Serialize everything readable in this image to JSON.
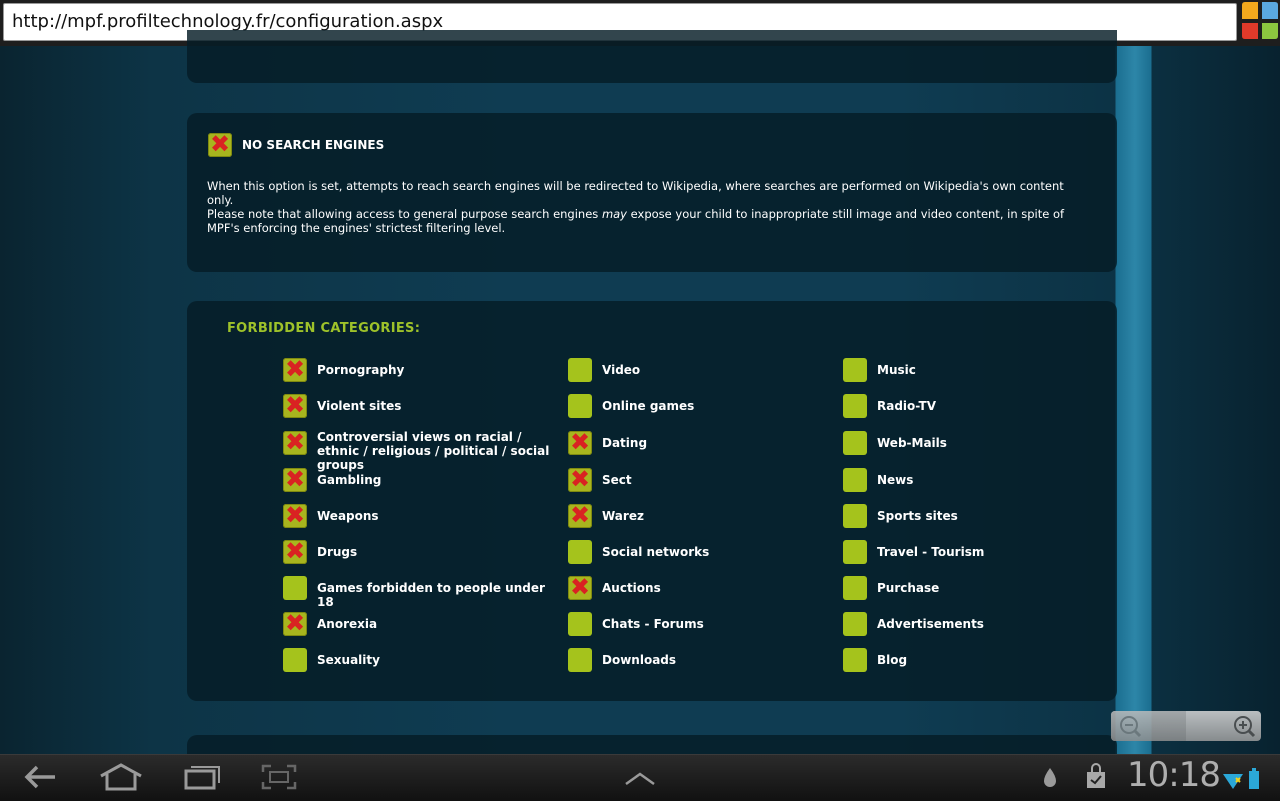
{
  "browser": {
    "url": "http://mpf.profiltechnology.fr/configuration.aspx"
  },
  "search_option": {
    "checked": true,
    "title": "NO SEARCH ENGINES",
    "paragraph1": "When this option is set, attempts to reach search engines will be redirected to Wikipedia, where searches are performed on Wikipedia's own content only.",
    "paragraph2_before": "Please note that allowing access to general purpose search engines ",
    "paragraph2_em": "may",
    "paragraph2_after": " expose your child to inappropriate still image and video content, in spite of MPF's enforcing the engines' strictest filtering level."
  },
  "categories": {
    "heading": "FORBIDDEN CATEGORIES:",
    "columns": [
      [
        {
          "label": "Pornography",
          "forbidden": true
        },
        {
          "label": "Violent sites",
          "forbidden": true
        },
        {
          "label": "Controversial views on racial / ethnic / religious / political / social groups",
          "forbidden": true
        },
        {
          "label": "Gambling",
          "forbidden": true
        },
        {
          "label": "Weapons",
          "forbidden": true
        },
        {
          "label": "Drugs",
          "forbidden": true
        },
        {
          "label": "Games forbidden to people under 18",
          "forbidden": false
        },
        {
          "label": "Anorexia",
          "forbidden": true
        },
        {
          "label": "Sexuality",
          "forbidden": false
        }
      ],
      [
        {
          "label": "Video",
          "forbidden": false
        },
        {
          "label": "Online games",
          "forbidden": false
        },
        {
          "label": "Dating",
          "forbidden": true
        },
        {
          "label": "Sect",
          "forbidden": true
        },
        {
          "label": "Warez",
          "forbidden": true
        },
        {
          "label": "Social networks",
          "forbidden": false
        },
        {
          "label": "Auctions",
          "forbidden": true
        },
        {
          "label": "Chats - Forums",
          "forbidden": false
        },
        {
          "label": "Downloads",
          "forbidden": false
        }
      ],
      [
        {
          "label": "Music",
          "forbidden": false
        },
        {
          "label": "Radio-TV",
          "forbidden": false
        },
        {
          "label": "Web-Mails",
          "forbidden": false
        },
        {
          "label": "News",
          "forbidden": false
        },
        {
          "label": "Sports sites",
          "forbidden": false
        },
        {
          "label": "Travel - Tourism",
          "forbidden": false
        },
        {
          "label": "Purchase",
          "forbidden": false
        },
        {
          "label": "Advertisements",
          "forbidden": false
        },
        {
          "label": "Blog",
          "forbidden": false
        }
      ]
    ]
  },
  "system_bar": {
    "clock": "10:18",
    "icons": [
      "back-icon",
      "home-icon",
      "recent-apps-icon",
      "screenshot-icon",
      "up-chevron-icon",
      "notification-icon",
      "shopping-bag-icon",
      "wifi-icon",
      "battery-icon"
    ]
  },
  "zoom": {
    "icons": [
      "zoom-out-icon",
      "zoom-in-icon"
    ]
  }
}
